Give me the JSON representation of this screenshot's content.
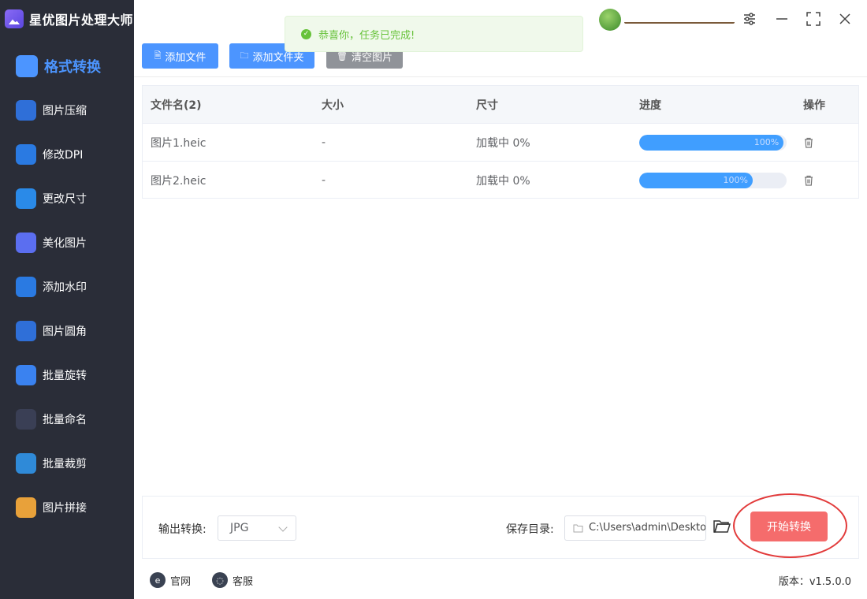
{
  "app": {
    "title": "星优图片处理大师"
  },
  "sidebar": {
    "items": [
      {
        "label": "格式转换",
        "icon": "format-convert-icon",
        "color": "#4c95ff",
        "active": true
      },
      {
        "label": "图片压缩",
        "icon": "compress-icon",
        "color": "#2f6fd8"
      },
      {
        "label": "修改DPI",
        "icon": "dpi-icon",
        "color": "#2a7ae2"
      },
      {
        "label": "更改尺寸",
        "icon": "resize-icon",
        "color": "#2a8ae8"
      },
      {
        "label": "美化图片",
        "icon": "beautify-icon",
        "color": "#5b6ef0"
      },
      {
        "label": "添加水印",
        "icon": "watermark-icon",
        "color": "#2a7ae2"
      },
      {
        "label": "图片圆角",
        "icon": "round-corner-icon",
        "color": "#2f6fd8"
      },
      {
        "label": "批量旋转",
        "icon": "rotate-icon",
        "color": "#3a82f0"
      },
      {
        "label": "批量命名",
        "icon": "rename-icon",
        "color": "#3a3f55"
      },
      {
        "label": "批量裁剪",
        "icon": "crop-icon",
        "color": "#2f8ad8"
      },
      {
        "label": "图片拼接",
        "icon": "stitch-icon",
        "color": "#e8a13a"
      }
    ]
  },
  "toast": {
    "message": "恭喜你，任务已完成!",
    "color": "#67c23a"
  },
  "toolbar": {
    "add_file": "添加文件",
    "add_folder": "添加文件夹",
    "clear": "清空图片",
    "primary_color": "#4c95ff",
    "clear_color": "#909399"
  },
  "table": {
    "headers": {
      "name": "文件名(2)",
      "size": "大小",
      "dims": "尺寸",
      "progress": "进度",
      "action": "操作"
    },
    "rows": [
      {
        "name": "图片1.heic",
        "size": "-",
        "dims": "加载中 0%",
        "progress_label": "100%",
        "progress": 0.98
      },
      {
        "name": "图片2.heic",
        "size": "-",
        "dims": "加载中 0%",
        "progress_label": "100%",
        "progress": 0.77
      }
    ]
  },
  "bottom": {
    "output_label": "输出转换:",
    "output_format": "JPG",
    "save_label": "保存目录:",
    "save_path": "C:\\Users\\admin\\Deskto",
    "start_button": "开始转换",
    "start_color": "#f56c6c"
  },
  "footer": {
    "website": "官网",
    "support": "客服",
    "version": "版本：v1.5.0.0"
  }
}
